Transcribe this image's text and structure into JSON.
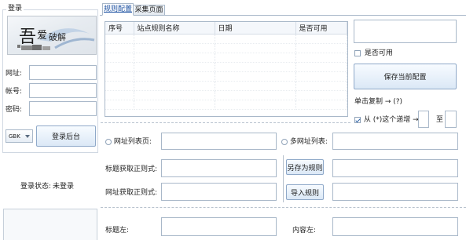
{
  "login": {
    "group_title": "登录",
    "url_label": "网址:",
    "account_label": "帐号:",
    "password_label": "密码:",
    "url_value": "",
    "account_value": "",
    "password_value": "",
    "encoding": "GBK",
    "login_button": "登录后台",
    "status_label": "登录状态:",
    "status_value": "未登录"
  },
  "tabs": [
    {
      "label": "规则配置",
      "active": true
    },
    {
      "label": "采集页面",
      "active": false
    }
  ],
  "rules_table": {
    "columns": [
      "序号",
      "站点规则名称",
      "日期",
      "是否可用"
    ],
    "rows": []
  },
  "right_panel": {
    "name_value": "",
    "enabled_label": "是否可用",
    "enabled_checked": false,
    "save_button": "保存当前配置",
    "copy_hint": "单击复制 → (?)",
    "range_label": "从 (*)这个递增 →",
    "range_checked": true,
    "range_to_label": "至",
    "range_from_value": "",
    "range_to_value": ""
  },
  "form": {
    "list_page_radio": "网址列表页:",
    "multi_url_radio": "多网址列表:",
    "title_regex_label": "标题获取正则式:",
    "url_regex_label": "网址获取正则式:",
    "save_as_rule": "另存为规则",
    "import_rule": "导入规则",
    "title_left_label": "标题左:",
    "content_left_label": "内容左:"
  },
  "colors": {
    "accent": "#2b62a8",
    "border": "#a9b8c9",
    "tab_active_text": "#1a4fa0"
  }
}
